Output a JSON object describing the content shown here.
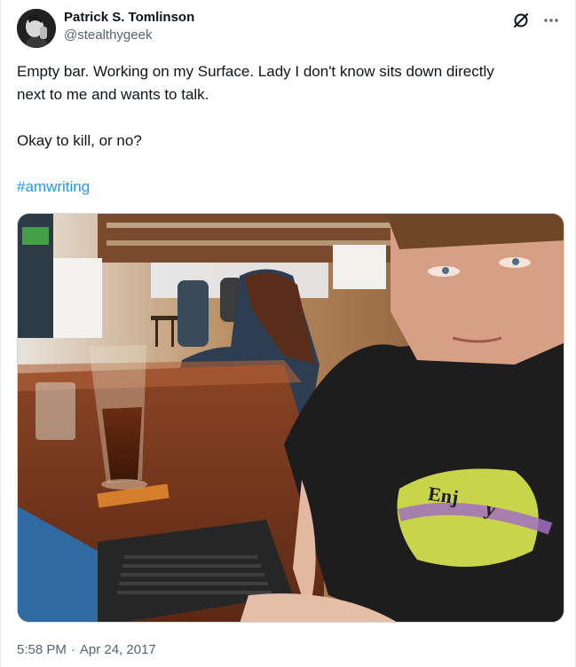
{
  "author": {
    "display_name": "Patrick S. Tomlinson",
    "handle": "@stealthygeek"
  },
  "tweet": {
    "line1": "Empty bar. Working on my Surface. Lady I don't know sits down directly",
    "line2": "next to me and wants to talk.",
    "line3": "Okay to kill, or no?",
    "hashtag": "#amwriting"
  },
  "media": {
    "shirt_text_1": "Enj",
    "shirt_text_2": "y"
  },
  "footer": {
    "time": "5:58 PM",
    "separator": "·",
    "date": "Apr 24, 2017"
  },
  "icons": {
    "header_action_1": "grok-icon",
    "header_action_2": "more-icon"
  },
  "colors": {
    "hashtag": "#1d9bf0",
    "secondary_text": "#536471",
    "primary_text": "#0f1419"
  }
}
